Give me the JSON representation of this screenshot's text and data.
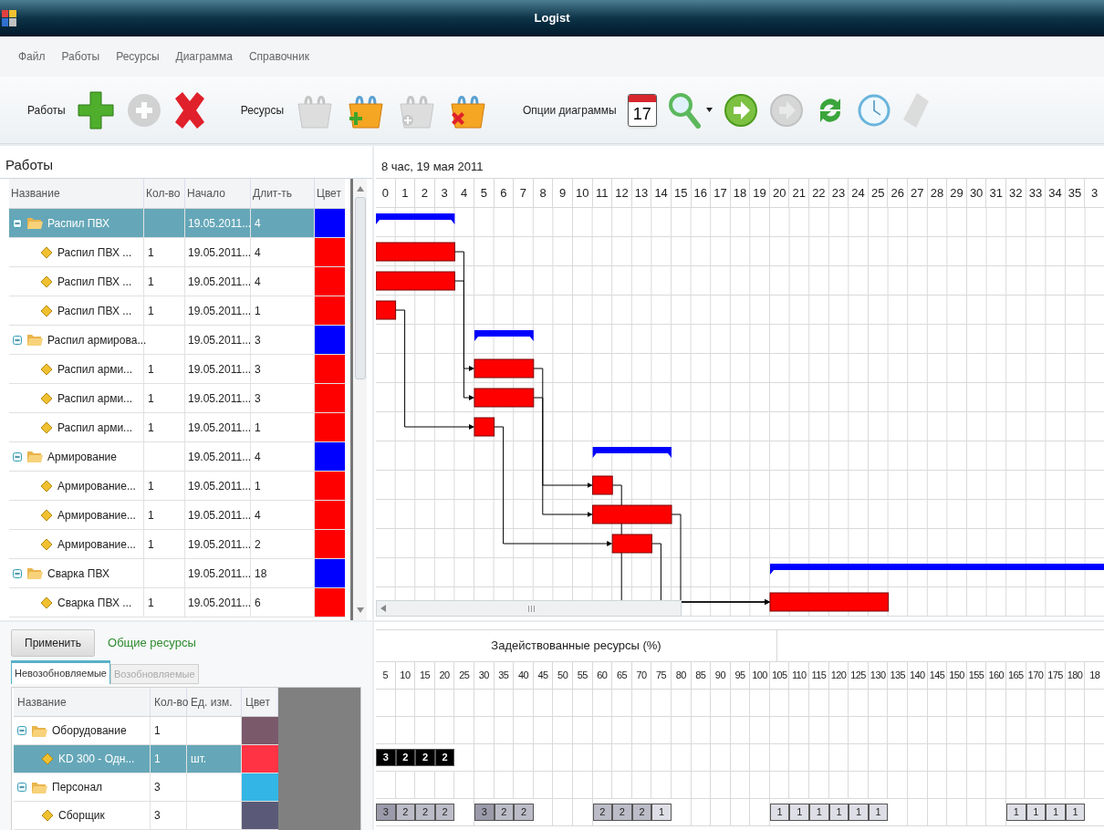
{
  "window": {
    "title": "Logist"
  },
  "menu": [
    "Файл",
    "Работы",
    "Ресурсы",
    "Диаграмма",
    "Справочник"
  ],
  "toolbar": [
    {
      "label": "Работы",
      "buttons": [
        {
          "kind": "add",
          "disabled": false
        },
        {
          "kind": "edit",
          "disabled": true
        },
        {
          "kind": "delete",
          "disabled": false
        }
      ]
    },
    {
      "label": "Ресурсы",
      "buttons": [
        {
          "kind": "basket",
          "disabled": true
        },
        {
          "kind": "basket_add",
          "disabled": false
        },
        {
          "kind": "basket_edit",
          "disabled": true
        },
        {
          "kind": "basket_delete",
          "disabled": false
        }
      ]
    },
    {
      "label": "Опции диаграммы",
      "buttons": [
        {
          "kind": "calendar",
          "text": "17",
          "disabled": false
        },
        {
          "kind": "zoom",
          "disabled": false
        },
        {
          "kind": "next",
          "disabled": false
        },
        {
          "kind": "next",
          "disabled": true
        },
        {
          "kind": "refresh",
          "disabled": false
        },
        {
          "kind": "clock",
          "disabled": false
        },
        {
          "kind": "tag",
          "disabled": true
        }
      ]
    }
  ],
  "works": {
    "title": "Работы",
    "columns": [
      "Название",
      "Кол-во",
      "Начало",
      "Длит-ть",
      "Цвет"
    ],
    "rows": [
      {
        "name": "Распил ПВХ",
        "start": "19.05.2011...",
        "duration": "4",
        "color": "#0000ff",
        "expanded": true,
        "selected": true,
        "children": [
          {
            "name": "Распил ПВХ ...",
            "qty": "1",
            "start": "19.05.2011...",
            "duration": "4",
            "color": "#ff0000",
            "selected": false
          },
          {
            "name": "Распил ПВХ ...",
            "qty": "1",
            "start": "19.05.2011...",
            "duration": "4",
            "color": "#ff0000",
            "selected": false
          },
          {
            "name": "Распил ПВХ ...",
            "qty": "1",
            "start": "19.05.2011...",
            "duration": "1",
            "color": "#ff0000",
            "selected": false
          }
        ]
      },
      {
        "name": "Распил армирова...",
        "start": "19.05.2011...",
        "duration": "3",
        "color": "#0000ff",
        "expanded": true,
        "selected": false,
        "children": [
          {
            "name": "Распил арми...",
            "qty": "1",
            "start": "19.05.2011...",
            "duration": "3",
            "color": "#ff0000",
            "selected": false
          },
          {
            "name": "Распил арми...",
            "qty": "1",
            "start": "19.05.2011...",
            "duration": "3",
            "color": "#ff0000",
            "selected": false
          },
          {
            "name": "Распил арми...",
            "qty": "1",
            "start": "19.05.2011...",
            "duration": "1",
            "color": "#ff0000",
            "selected": false
          }
        ]
      },
      {
        "name": "Армирование",
        "start": "19.05.2011...",
        "duration": "4",
        "color": "#0000ff",
        "expanded": true,
        "selected": false,
        "children": [
          {
            "name": "Армирование...",
            "qty": "1",
            "start": "19.05.2011...",
            "duration": "1",
            "color": "#ff0000",
            "selected": false
          },
          {
            "name": "Армирование...",
            "qty": "1",
            "start": "19.05.2011...",
            "duration": "4",
            "color": "#ff0000",
            "selected": false
          },
          {
            "name": "Армирование...",
            "qty": "1",
            "start": "19.05.2011...",
            "duration": "2",
            "color": "#ff0000",
            "selected": false
          }
        ]
      },
      {
        "name": "Сварка ПВХ",
        "start": "19.05.2011...",
        "duration": "18",
        "color": "#0000ff",
        "expanded": true,
        "selected": false,
        "children": [
          {
            "name": "Сварка ПВХ ...",
            "qty": "1",
            "start": "19.05.2011...",
            "duration": "6",
            "color": "#ff0000",
            "selected": false
          }
        ]
      }
    ]
  },
  "gantt": {
    "date_label": "8 час, 19 мая 2011",
    "hours": [
      "0",
      "1",
      "2",
      "3",
      "4",
      "5",
      "6",
      "7",
      "8",
      "9",
      "10",
      "11",
      "12",
      "13",
      "14",
      "15",
      "16",
      "17",
      "18",
      "19",
      "20",
      "21",
      "22",
      "23",
      "24",
      "25",
      "26",
      "27",
      "28",
      "29",
      "30",
      "31",
      "32",
      "33",
      "34",
      "35",
      "3"
    ]
  },
  "resources": {
    "apply_button": "Применить",
    "title": "Общие ресурсы",
    "tabs": [
      {
        "label": "Невозобновляемые",
        "selected": true
      },
      {
        "label": "Возобновляемые",
        "selected": false
      }
    ],
    "columns": [
      "Название",
      "Кол-во",
      "Ед. изм.",
      "Цвет"
    ],
    "rows": [
      {
        "name": "Оборудование",
        "qty": "1",
        "color": "#7a5a6a",
        "expanded": true,
        "selected": false,
        "children": [
          {
            "name": "KD 300 - Одн...",
            "qty": "1",
            "unit": "шт.",
            "color": "#ff3344",
            "selected": true
          }
        ]
      },
      {
        "name": "Персонал",
        "qty": "3",
        "color": "#33b5e5",
        "expanded": true,
        "selected": false,
        "children": [
          {
            "name": "Сборщик",
            "qty": "3",
            "color": "#5a5a78",
            "selected": false
          }
        ]
      }
    ]
  },
  "load": {
    "title": "Задействованные ресурсы (%)",
    "columns": [
      "5",
      "10",
      "15",
      "20",
      "25",
      "30",
      "35",
      "40",
      "45",
      "50",
      "55",
      "60",
      "65",
      "70",
      "75",
      "80",
      "85",
      "90",
      "95",
      "100",
      "105",
      "110",
      "115",
      "120",
      "125",
      "130",
      "135",
      "140",
      "145",
      "150",
      "155",
      "160",
      "165",
      "170",
      "175",
      "180",
      "18"
    ],
    "rows": [
      {
        "cells": [
          {
            "text": "3",
            "color": "#000000"
          },
          {
            "text": "2",
            "color": "#000000"
          },
          {
            "text": "2",
            "color": "#000000"
          },
          {
            "text": "2",
            "color": "#000000"
          }
        ]
      },
      {
        "cells": [
          {
            "text": "3",
            "color": "#9a9aaa"
          },
          {
            "text": "2",
            "color": "#bcbcc8"
          },
          {
            "text": "2",
            "color": "#bcbcc8"
          },
          {
            "text": "2",
            "color": "#bcbcc8"
          },
          null,
          {
            "text": "3",
            "color": "#9a9aaa"
          },
          {
            "text": "2",
            "color": "#bcbcc8"
          },
          {
            "text": "2",
            "color": "#bcbcc8"
          },
          null,
          null,
          null,
          {
            "text": "2",
            "color": "#bcbcc8"
          },
          {
            "text": "2",
            "color": "#bcbcc8"
          },
          {
            "text": "2",
            "color": "#bcbcc8"
          },
          {
            "text": "1",
            "color": "#dedee6"
          },
          null,
          null,
          null,
          null,
          null,
          {
            "text": "1",
            "color": "#dedee6"
          },
          {
            "text": "1",
            "color": "#dedee6"
          },
          {
            "text": "1",
            "color": "#dedee6"
          },
          {
            "text": "1",
            "color": "#dedee6"
          },
          {
            "text": "1",
            "color": "#dedee6"
          },
          {
            "text": "1",
            "color": "#dedee6"
          },
          null,
          null,
          null,
          null,
          null,
          null,
          {
            "text": "1",
            "color": "#dedee6"
          },
          {
            "text": "1",
            "color": "#dedee6"
          },
          {
            "text": "1",
            "color": "#dedee6"
          },
          {
            "text": "1",
            "color": "#dedee6"
          }
        ]
      }
    ]
  }
}
